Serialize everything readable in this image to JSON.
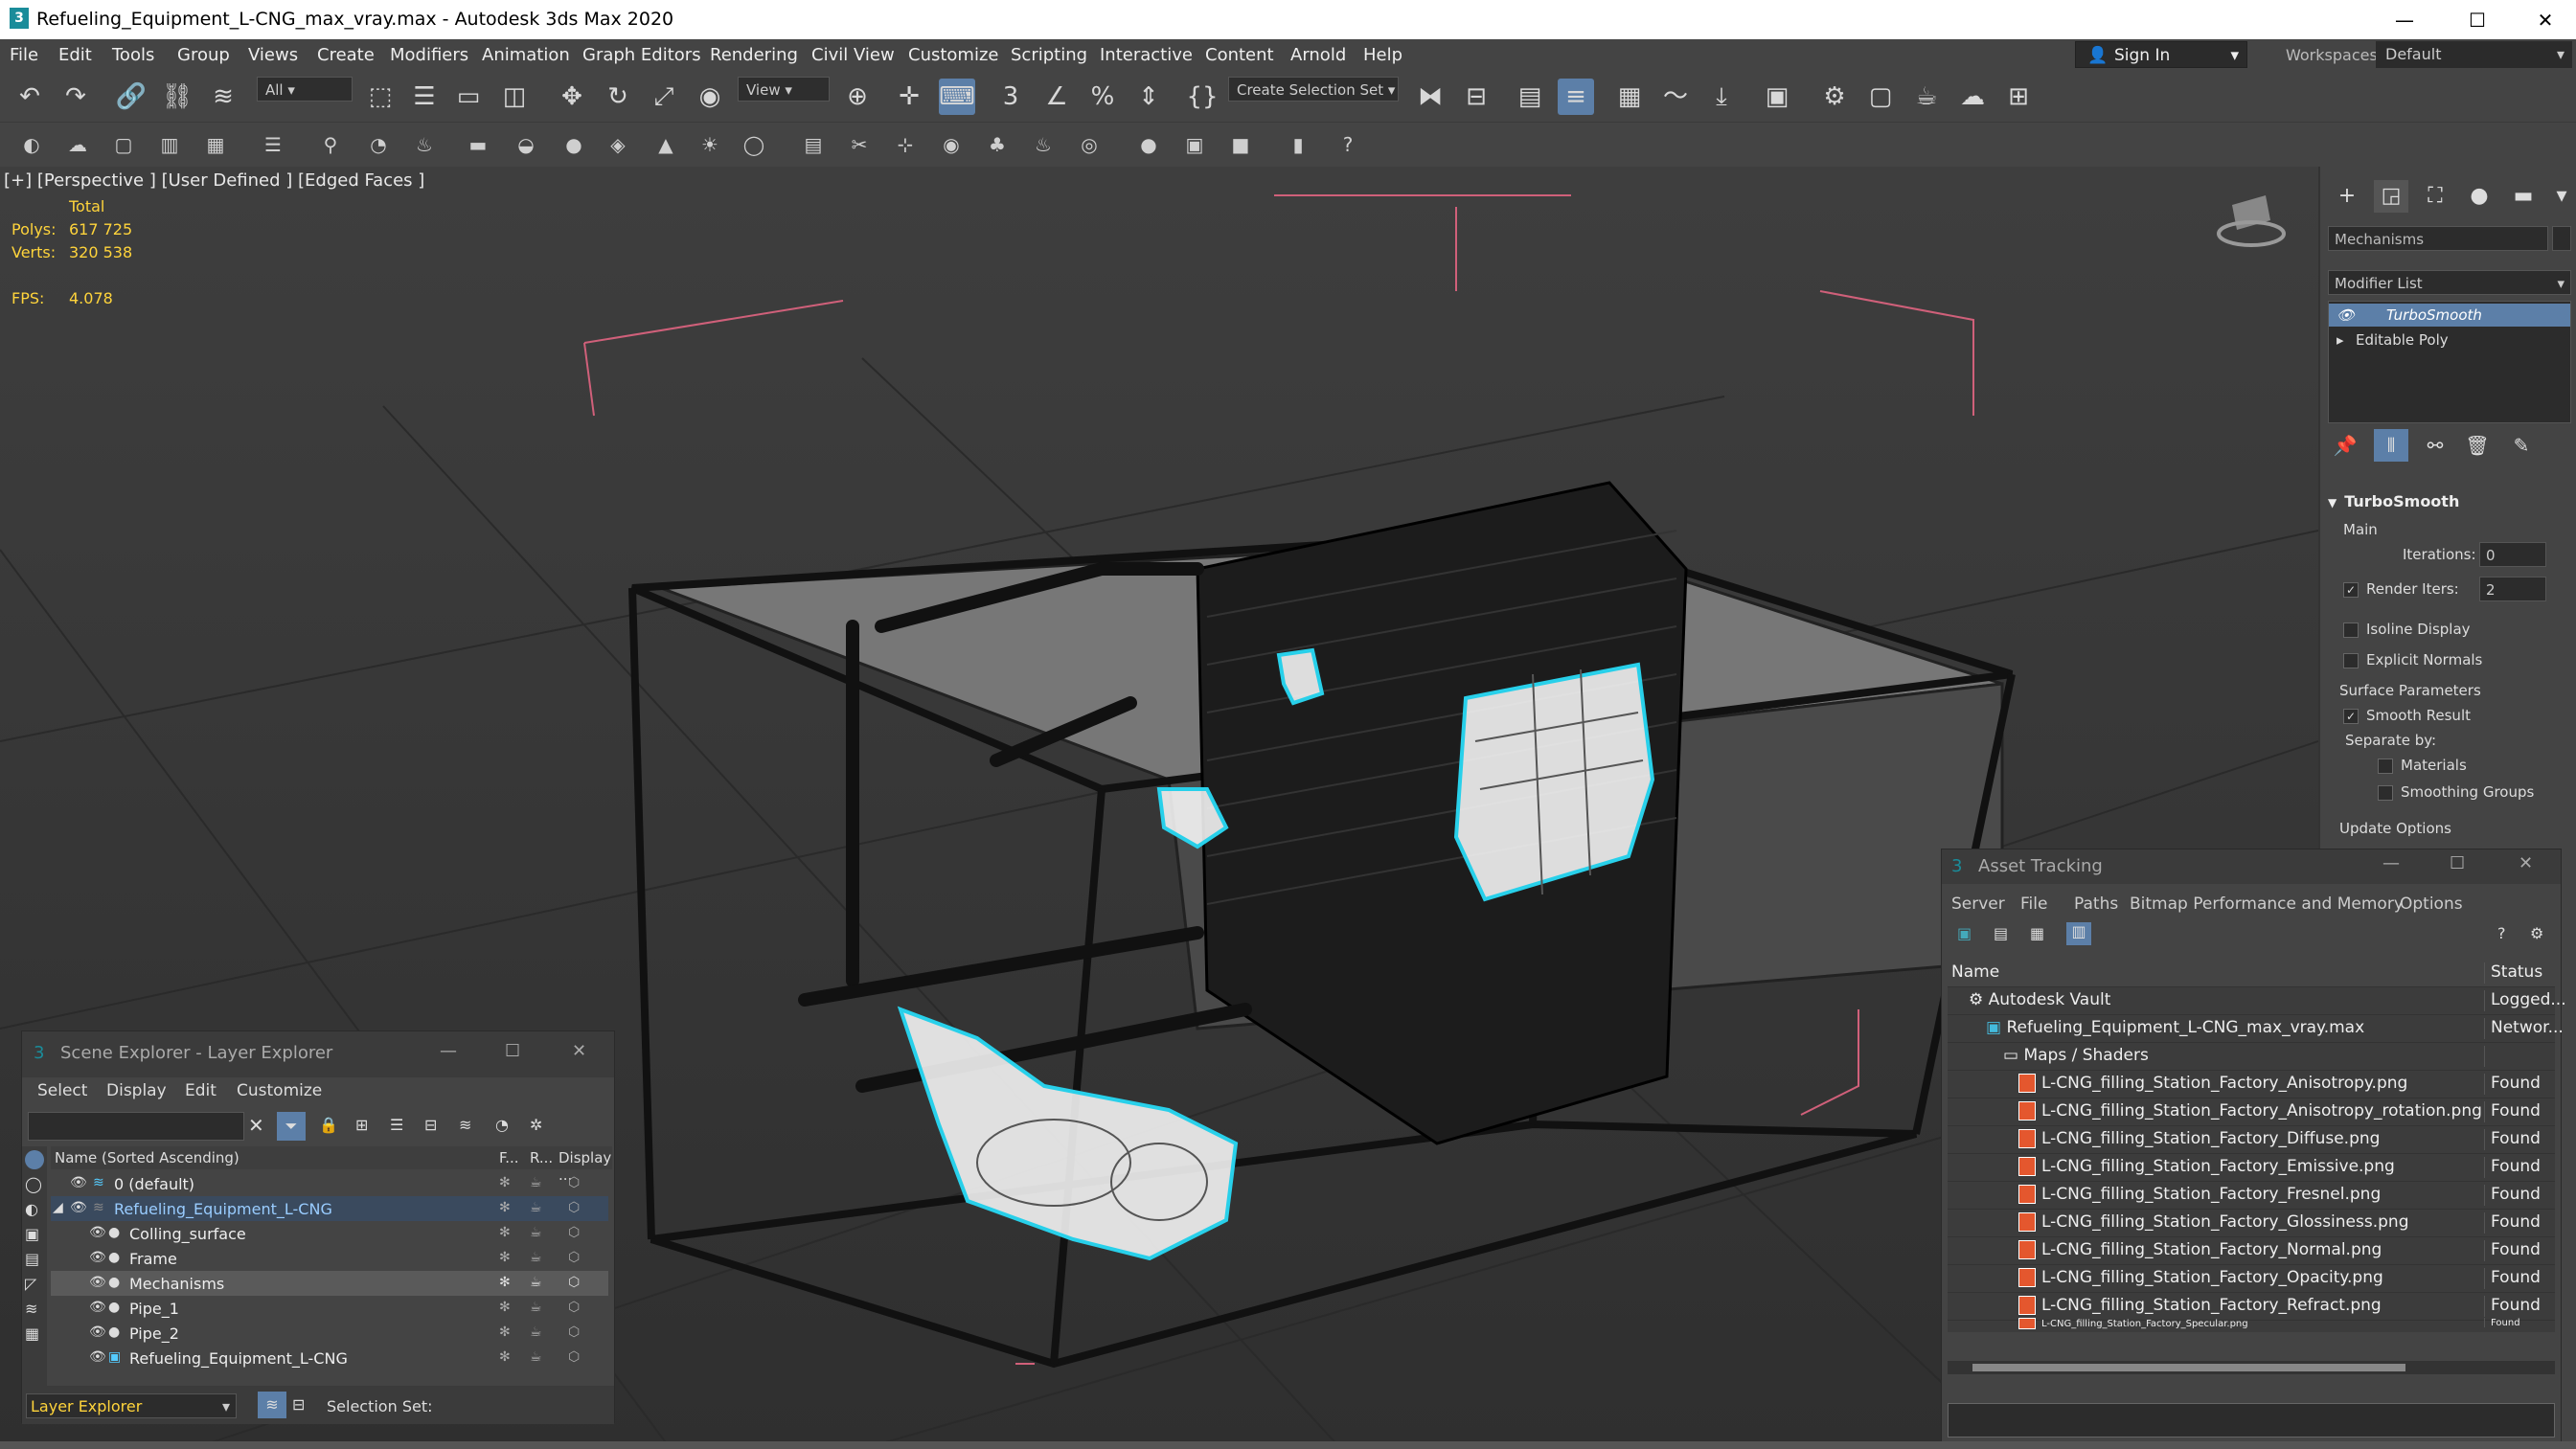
{
  "window": {
    "title": "Refueling_Equipment_L-CNG_max_vray.max - Autodesk 3ds Max 2020",
    "app_icon": "3",
    "minimize": "—",
    "maximize": "☐",
    "close": "✕"
  },
  "menu": [
    "File",
    "Edit",
    "Tools",
    "Group",
    "Views",
    "Create",
    "Modifiers",
    "Animation",
    "Graph Editors",
    "Rendering",
    "Civil View",
    "Customize",
    "Scripting",
    "Interactive",
    "Content",
    "Arnold",
    "Help"
  ],
  "signin": {
    "label": "Sign In"
  },
  "workspaces": {
    "label": "Workspaces:",
    "value": "Default"
  },
  "toolbar": {
    "filter_value": "All",
    "coord_value": "View",
    "selection_set": "Create Selection Set"
  },
  "viewport": {
    "label": "[+] [Perspective ] [User Defined ] [Edged Faces ]",
    "stats_header": "Total",
    "polys_label": "Polys:",
    "polys_value": "617 725",
    "verts_label": "Verts:",
    "verts_value": "320 538",
    "fps_label": "FPS:",
    "fps_value": "4.078"
  },
  "command_panel": {
    "object_name": "Mechanisms",
    "modifier_list": "Modifier List",
    "stack": [
      "TurboSmooth",
      "Editable Poly"
    ],
    "rollout_title": "TurboSmooth",
    "main_label": "Main",
    "iterations_label": "Iterations:",
    "iterations_value": "0",
    "render_iters_label": "Render Iters:",
    "render_iters_value": "2",
    "isoline": "Isoline Display",
    "explicit_normals": "Explicit Normals",
    "surface_params": "Surface Parameters",
    "smooth_result": "Smooth Result",
    "separate_by": "Separate by:",
    "materials": "Materials",
    "smoothing_groups": "Smoothing Groups",
    "update_options": "Update Options"
  },
  "asset_tracking": {
    "title": "Asset Tracking",
    "menu": [
      "Server",
      "File",
      "Paths",
      "Bitmap Performance and Memory",
      "Options"
    ],
    "col_name": "Name",
    "col_status": "Status",
    "rows": [
      {
        "name": "Autodesk Vault",
        "status": "Logged..."
      },
      {
        "name": "Refueling_Equipment_L-CNG_max_vray.max",
        "status": "Networ..."
      },
      {
        "name": "Maps / Shaders",
        "status": ""
      },
      {
        "name": "L-CNG_filling_Station_Factory_Anisotropy.png",
        "status": "Found"
      },
      {
        "name": "L-CNG_filling_Station_Factory_Anisotropy_rotation.png",
        "status": "Found"
      },
      {
        "name": "L-CNG_filling_Station_Factory_Diffuse.png",
        "status": "Found"
      },
      {
        "name": "L-CNG_filling_Station_Factory_Emissive.png",
        "status": "Found"
      },
      {
        "name": "L-CNG_filling_Station_Factory_Fresnel.png",
        "status": "Found"
      },
      {
        "name": "L-CNG_filling_Station_Factory_Glossiness.png",
        "status": "Found"
      },
      {
        "name": "L-CNG_filling_Station_Factory_Normal.png",
        "status": "Found"
      },
      {
        "name": "L-CNG_filling_Station_Factory_Opacity.png",
        "status": "Found"
      },
      {
        "name": "L-CNG_filling_Station_Factory_Refract.png",
        "status": "Found"
      },
      {
        "name": "L-CNG_filling_Station_Factory_Specular.png",
        "status": "Found"
      }
    ]
  },
  "scene_explorer": {
    "title": "Scene Explorer - Layer Explorer",
    "menu": [
      "Select",
      "Display",
      "Edit",
      "Customize"
    ],
    "col_name": "Name (Sorted Ascending)",
    "col_f": "F...",
    "col_r": "R...",
    "col_display": "Display ...",
    "rows": [
      {
        "name": "0 (default)"
      },
      {
        "name": "Refueling_Equipment_L-CNG"
      },
      {
        "name": "Colling_surface"
      },
      {
        "name": "Frame"
      },
      {
        "name": "Mechanisms"
      },
      {
        "name": "Pipe_1"
      },
      {
        "name": "Pipe_2"
      },
      {
        "name": "Refueling_Equipment_L-CNG"
      }
    ],
    "footer_explorer": "Layer Explorer",
    "footer_selection": "Selection Set:"
  }
}
